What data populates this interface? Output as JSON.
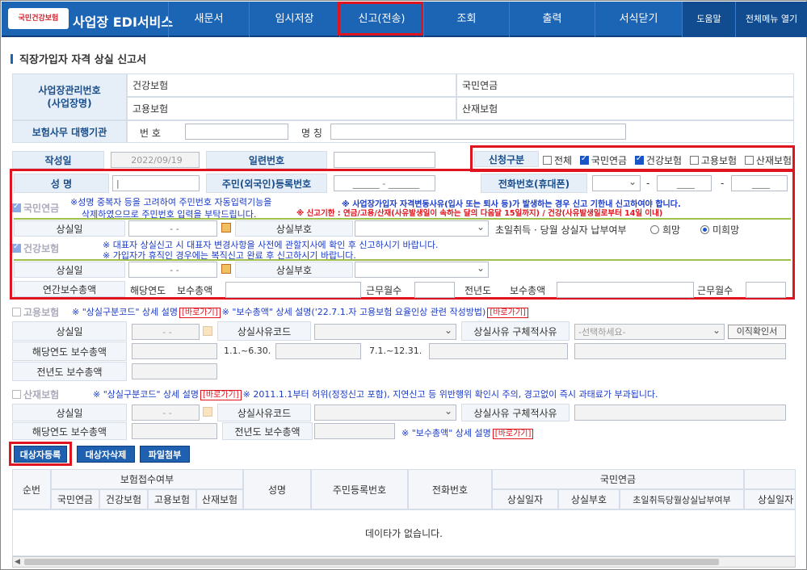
{
  "nav": {
    "logo_text": "국민건강보험",
    "app_title": "사업장 EDI서비스",
    "items": [
      "새문서",
      "임시저장",
      "신고(전송)",
      "조회",
      "출력",
      "서식닫기"
    ],
    "help": "도움말",
    "all_menu": "전체메뉴 열기"
  },
  "page_title": "직장가입자 자격 상실 신고서",
  "biz": {
    "num_label": "사업장관리번호\n(사업장명)",
    "health": "건강보험",
    "employ": "고용보험",
    "pension": "국민연금",
    "accident": "산재보험",
    "agency_label": "보험사무 대행기관",
    "no": "번 호",
    "name": "명 칭"
  },
  "form": {
    "date_label": "작성일",
    "date_value": "2022/09/19",
    "serial_label": "일련번호",
    "apply_label": "신청구분",
    "apply_all": "전체",
    "apply_pension": "국민연금",
    "apply_health": "건강보험",
    "apply_employ": "고용보험",
    "apply_accident": "산재보험"
  },
  "person": {
    "name_label": "성 명",
    "rrn_label": "주민(외국인)등록번호",
    "rrn_value": "______ - _______",
    "phone_label": "전화번호(휴대폰)",
    "phone_dash1": "-",
    "phone_mid": "____",
    "phone_dash2": "-",
    "phone_last": "____"
  },
  "pension": {
    "title": "국민연금",
    "note1": "※성명 중복자 등을 고려하여 주민번호 자동입력기능을",
    "note2": "삭제하였으므로 주민번호 입력을 부탁드립니다.",
    "notice1": "※ 사업장가입자 자격변동사유(입사 또는 퇴사 등)가 발생하는 경우 신고 기한내 신고하여야 합니다.",
    "notice2": "※ 신고기한 : 연금/고용/산재(사유발생일이 속하는 달의 다음달 15일까지) / 건강(사유발생일로부터 14일 이내)",
    "loss_date": "상실일",
    "date_placeholder": "- -",
    "loss_code": "상실부호",
    "first_pay": "초일취득 · 당월 상실자 납부여부",
    "hope": "희망",
    "no_hope": "미희망"
  },
  "health": {
    "title": "건강보험",
    "note1": "※ 대표자 상실신고 시 대표자 변경사항을 사전에 관할지사에 확인 후 신고하시기 바랍니다.",
    "note2": "※ 가입자가 휴직인 경우에는 복직신고 완료 후 신고하시기 바랍니다.",
    "loss_date": "상실일",
    "date_placeholder": "- -",
    "loss_code": "상실부호",
    "annual": "연간보수총액",
    "cur_year": "해당연도",
    "total_pay": "보수총액",
    "months": "근무월수",
    "prev_year": "전년도",
    "total_pay2": "보수총액",
    "months2": "근무월수"
  },
  "employ": {
    "title": "고용보험",
    "desc_a": "※ \"상실구분코드\" 상세 설명",
    "link": "[바로가기]",
    "desc_b": "※ \"보수총액\" 상세 설명('22.7.1.자 고용보험 요율인상 관련 작성방법)",
    "link2": "[바로가기]",
    "loss_date": "상실일",
    "date_placeholder": "- -",
    "reason_code": "상실사유코드",
    "reason_detail": "상실사유 구체적사유",
    "reason_select": "-선택하세요-",
    "transfer_btn": "이직확인서",
    "cur_pay": "해당연도 보수총액",
    "period1": "1.1.~6.30.",
    "period2": "7.1.~12.31.",
    "prev_pay": "전년도 보수총액"
  },
  "accident": {
    "title": "산재보험",
    "desc_a": "※ \"상실구분코드\" 상세 설명",
    "link": "[바로가기]",
    "desc_b": "※ 2011.1.1부터 허위(정정신고 포함), 지연신고 등 위반행위 확인시 주의, 경고없이 즉시 과태료가 부과됩니다.",
    "loss_date": "상실일",
    "date_placeholder": "- -",
    "reason_code": "상실사유코드",
    "reason_detail": "상실사유 구체적사유",
    "cur_pay": "해당연도 보수총액",
    "prev_pay": "전년도 보수총액",
    "pay_desc": "※ \"보수총액\" 상세 설명",
    "link2": "[바로가기]"
  },
  "buttons": {
    "register": "대상자등록",
    "delete": "대상자삭제",
    "attach": "파일첨부"
  },
  "table": {
    "no": "순번",
    "receipt": "보험접수여부",
    "sub": [
      "국민연금",
      "건강보험",
      "고용보험",
      "산재보험"
    ],
    "name": "성명",
    "rrn": "주민등록번호",
    "phone": "전화번호",
    "pension": "국민연금",
    "pcols": [
      "상실일자",
      "상실부호",
      "초일취득당월상실납부여부",
      "상실일자"
    ],
    "empty": "데이타가 없습니다."
  }
}
